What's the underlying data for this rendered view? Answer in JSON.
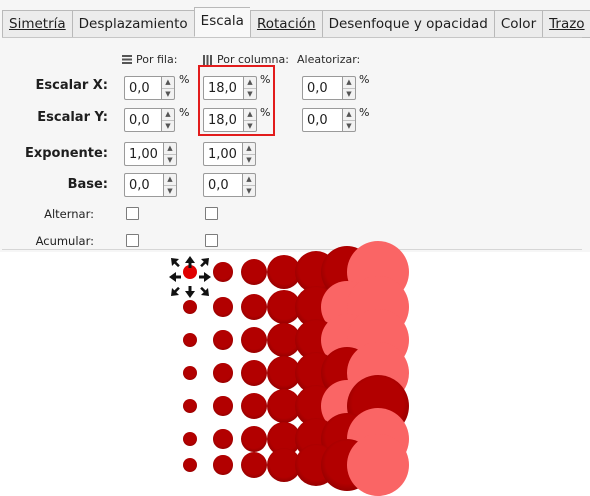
{
  "tabs": [
    {
      "label": "Simetría"
    },
    {
      "label": "Desplazamiento"
    },
    {
      "label": "Escala"
    },
    {
      "label": "Rotación"
    },
    {
      "label": "Desenfoque y opacidad"
    },
    {
      "label": "Color"
    },
    {
      "label": "Trazo"
    }
  ],
  "active_tab": "Escala",
  "columns": {
    "by_row": "Por fila:",
    "by_column": "Por columna:",
    "randomize": "Aleatorizar:"
  },
  "rows": {
    "scale_x": {
      "label": "Escalar X:",
      "by_row": "0,0",
      "by_column": "18,0",
      "randomize": "0,0",
      "unit": "%"
    },
    "scale_y": {
      "label": "Escalar Y:",
      "by_row": "0,0",
      "by_column": "18,0",
      "randomize": "0,0",
      "unit": "%"
    },
    "exponent": {
      "label": "Exponente:",
      "by_row": "1,00",
      "by_column": "1,00"
    },
    "base": {
      "label": "Base:",
      "by_row": "0,0",
      "by_column": "0,0"
    },
    "alternate": {
      "label": "Alternar:",
      "by_row": false,
      "by_column": false
    },
    "cumulate": {
      "label": "Acumular:",
      "by_row": false,
      "by_column": false
    }
  },
  "colors": {
    "highlight_box": "#e21c1c",
    "dot_dark": "#b20000",
    "dot_light": "#fa6565",
    "dot_selected": "#e00000"
  },
  "canvas": {
    "grid_rows": 7,
    "grid_columns": 7,
    "column_scale_percent": [
      100,
      118,
      136,
      154,
      172,
      190,
      208
    ],
    "light_dots": [
      [
        0,
        6
      ],
      [
        1,
        5
      ],
      [
        1,
        6
      ],
      [
        2,
        5
      ],
      [
        2,
        6
      ],
      [
        3,
        6
      ],
      [
        4,
        5
      ],
      [
        5,
        6
      ],
      [
        6,
        6
      ]
    ],
    "selected_dot": [
      0,
      0
    ],
    "selection_handles": "arrow-handles-icon"
  }
}
